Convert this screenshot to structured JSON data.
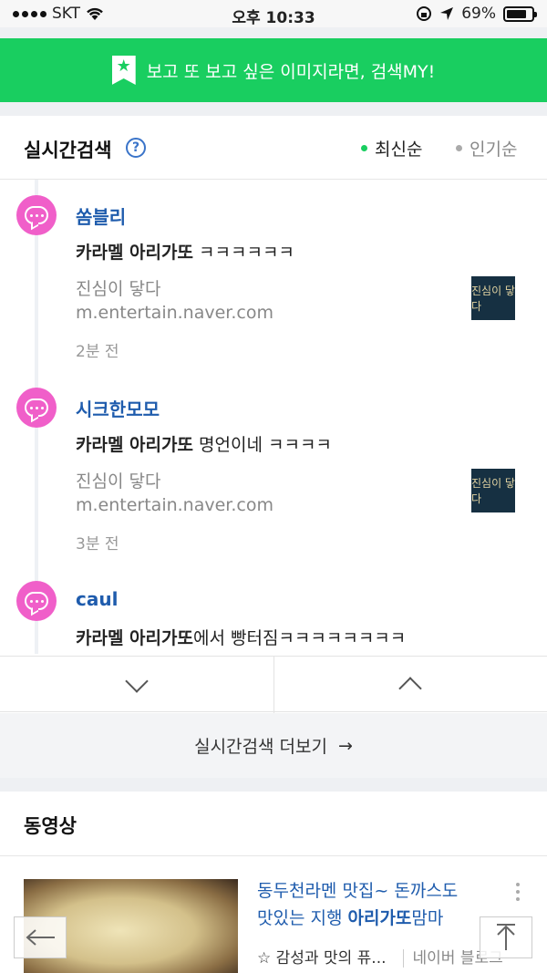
{
  "status": {
    "carrier": "SKT",
    "time": "오후 10:33",
    "battery": "69%"
  },
  "banner": {
    "text": "보고 또 보고 싶은 이미지라면, 검색MY!"
  },
  "realtime": {
    "title": "실시간검색",
    "help": "?",
    "sort_latest": "최신순",
    "sort_popular": "인기순",
    "items": [
      {
        "author": "쏨블리",
        "keyword": "카라멜 아리가또",
        "rest": " ㅋㅋㅋㅋㅋㅋ",
        "source": "진심이 닿다",
        "domain": "m.entertain.naver.com",
        "ago": "2분 전",
        "thumb": "진심이 닿다"
      },
      {
        "author": "시크한모모",
        "keyword": "카라멜 아리가또",
        "rest": " 명언이네 ㅋㅋㅋㅋ",
        "source": "진심이 닿다",
        "domain": "m.entertain.naver.com",
        "ago": "3분 전",
        "thumb": "진심이 닿다"
      },
      {
        "author": "caul",
        "keyword": "카라멜 아리가또",
        "rest": "에서 빵터짐ㅋㅋㅋㅋㅋㅋㅋㅋ"
      }
    ],
    "more": "실시간검색 더보기",
    "more_arrow": "→"
  },
  "video": {
    "title": "동영상",
    "line1": "동두천라멘 맛집~ 돈까스도",
    "line2_pre": "맛있는 지행 ",
    "line2_bold": "아리가또",
    "line2_post": "맘마",
    "meta": "☆ 감성과 맛의 퓨...",
    "blog": "네이버 블로그"
  },
  "fab": {
    "back": "←",
    "top": "↑"
  }
}
